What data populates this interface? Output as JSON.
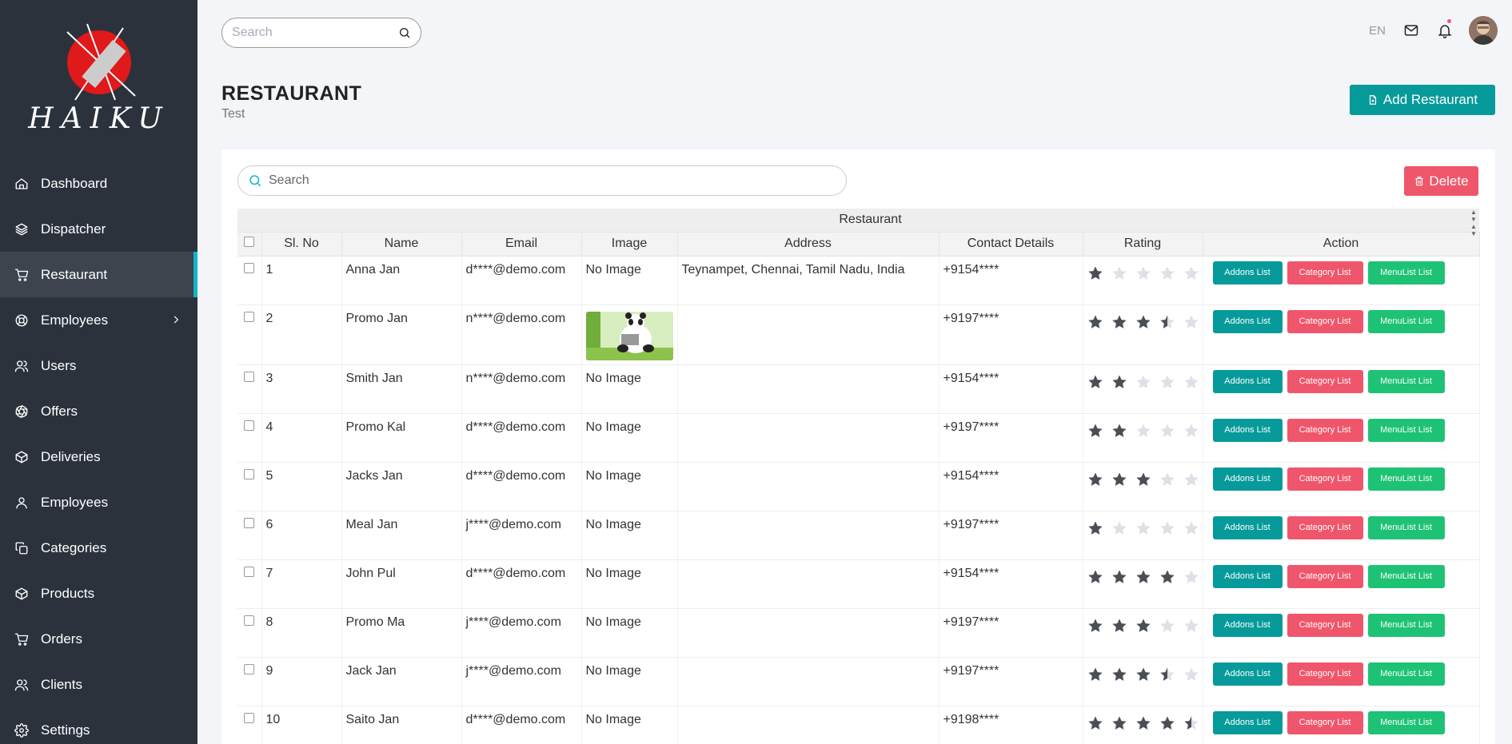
{
  "brand": {
    "name": "HAIKU"
  },
  "sidebar": {
    "items": [
      {
        "label": "Dashboard",
        "icon": "home-icon"
      },
      {
        "label": "Dispatcher",
        "icon": "layers-icon"
      },
      {
        "label": "Restaurant",
        "icon": "cart-icon",
        "active": true
      },
      {
        "label": "Employees",
        "icon": "lifebuoy-icon",
        "has_submenu": true
      },
      {
        "label": "Users",
        "icon": "users-icon"
      },
      {
        "label": "Offers",
        "icon": "aperture-icon"
      },
      {
        "label": "Deliveries",
        "icon": "box-icon"
      },
      {
        "label": "Employees",
        "icon": "user-icon"
      },
      {
        "label": "Categories",
        "icon": "copy-icon"
      },
      {
        "label": "Products",
        "icon": "box-icon"
      },
      {
        "label": "Orders",
        "icon": "cart-icon"
      },
      {
        "label": "Clients",
        "icon": "users-icon"
      },
      {
        "label": "Settings",
        "icon": "gear-icon"
      }
    ]
  },
  "topbar": {
    "search_placeholder": "Search",
    "language": "EN"
  },
  "page": {
    "title": "RESTAURANT",
    "subtitle": "Test",
    "add_button": "Add Restaurant"
  },
  "table": {
    "search_placeholder": "Search",
    "delete_button": "Delete",
    "group_header": "Restaurant",
    "columns": [
      "Sl. No",
      "Name",
      "Email",
      "Image",
      "Address",
      "Contact Details",
      "Rating",
      "Action"
    ],
    "action_labels": {
      "addons": "Addons List",
      "category": "Category List",
      "menu": "MenuList List"
    },
    "rows": [
      {
        "sl": "1",
        "name": "Anna Jan",
        "email": "d****@demo.com",
        "image": "No Image",
        "address": "Teynampet, Chennai, Tamil Nadu, India",
        "contact": "+9154****",
        "rating": 1
      },
      {
        "sl": "2",
        "name": "Promo Jan",
        "email": "n****@demo.com",
        "image": "",
        "address": "",
        "contact": "+9197****",
        "rating": 3.5
      },
      {
        "sl": "3",
        "name": "Smith Jan",
        "email": "n****@demo.com",
        "image": "No Image",
        "address": "",
        "contact": "+9154****",
        "rating": 2
      },
      {
        "sl": "4",
        "name": "Promo Kal",
        "email": "d****@demo.com",
        "image": "No Image",
        "address": "",
        "contact": "+9197****",
        "rating": 2
      },
      {
        "sl": "5",
        "name": "Jacks Jan",
        "email": "d****@demo.com",
        "image": "No Image",
        "address": "",
        "contact": "+9154****",
        "rating": 3
      },
      {
        "sl": "6",
        "name": "Meal Jan",
        "email": "j****@demo.com",
        "image": "No Image",
        "address": "",
        "contact": "+9197****",
        "rating": 1
      },
      {
        "sl": "7",
        "name": "John Pul",
        "email": "d****@demo.com",
        "image": "No Image",
        "address": "",
        "contact": "+9154****",
        "rating": 4
      },
      {
        "sl": "8",
        "name": "Promo Ma",
        "email": "j****@demo.com",
        "image": "No Image",
        "address": "",
        "contact": "+9197****",
        "rating": 3
      },
      {
        "sl": "9",
        "name": "Jack Jan",
        "email": "j****@demo.com",
        "image": "No Image",
        "address": "",
        "contact": "+9197****",
        "rating": 3.5
      },
      {
        "sl": "10",
        "name": "Saito Jan",
        "email": "d****@demo.com",
        "image": "No Image",
        "address": "",
        "contact": "+9198****",
        "rating": 4.5
      }
    ]
  },
  "colors": {
    "sidebar_bg": "#2c323c",
    "accent": "#0fb8c9",
    "teal_button": "#079a9a",
    "red_button": "#f0566b",
    "green_button": "#1ec275"
  }
}
